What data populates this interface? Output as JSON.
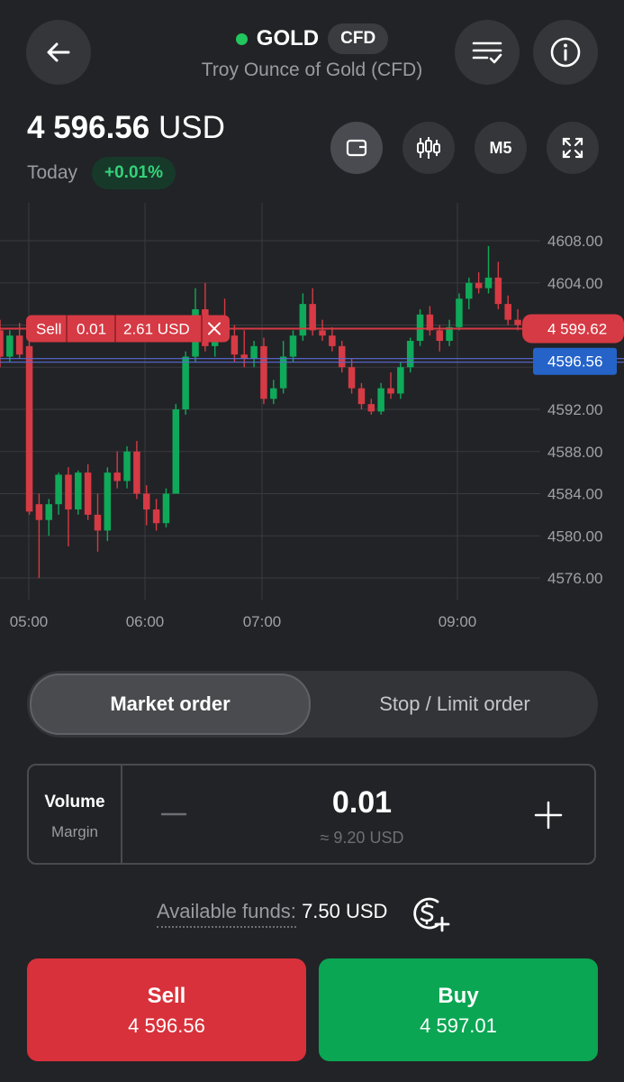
{
  "header": {
    "symbol": "GOLD",
    "badge": "CFD",
    "subtitle": "Troy Ounce of Gold (CFD)"
  },
  "price": {
    "value": "4 596.56",
    "currency": "USD",
    "period": "Today",
    "change": "+0.01%"
  },
  "toolbar": {
    "timeframe": "M5"
  },
  "chart_data": {
    "type": "candlestick",
    "y_ticks": [
      "4608.00",
      "4604.00",
      "4600.00",
      "4596.00",
      "4592.00",
      "4588.00",
      "4584.00",
      "4580.00",
      "4576.00"
    ],
    "x_ticks": [
      "05:00",
      "06:00",
      "07:00",
      "09:00"
    ],
    "ylim": [
      4574,
      4611
    ],
    "colors": {
      "up": "#0fa95a",
      "down": "#d63a44"
    },
    "order_line": {
      "side": "Sell",
      "volume": "0.01",
      "pnl": "2.61 USD",
      "price": "4 599.62"
    },
    "current_price_tag": "4596.56",
    "candles": [
      {
        "o": 4599.5,
        "h": 4600.5,
        "l": 4596.0,
        "c": 4597.0
      },
      {
        "o": 4597.0,
        "h": 4599.5,
        "l": 4596.5,
        "c": 4599.0
      },
      {
        "o": 4599.0,
        "h": 4600.2,
        "l": 4596.8,
        "c": 4597.2
      },
      {
        "o": 4598.0,
        "h": 4598.5,
        "l": 4582.0,
        "c": 4582.3
      },
      {
        "o": 4583.0,
        "h": 4584.0,
        "l": 4576.0,
        "c": 4581.5
      },
      {
        "o": 4581.5,
        "h": 4583.5,
        "l": 4580.0,
        "c": 4583.0
      },
      {
        "o": 4583.0,
        "h": 4586.0,
        "l": 4582.0,
        "c": 4585.8
      },
      {
        "o": 4585.8,
        "h": 4586.5,
        "l": 4579.0,
        "c": 4582.5
      },
      {
        "o": 4582.5,
        "h": 4586.2,
        "l": 4582.0,
        "c": 4586.0
      },
      {
        "o": 4586.0,
        "h": 4586.8,
        "l": 4581.5,
        "c": 4582.0
      },
      {
        "o": 4582.0,
        "h": 4584.0,
        "l": 4578.5,
        "c": 4580.5
      },
      {
        "o": 4580.5,
        "h": 4586.5,
        "l": 4579.5,
        "c": 4586.0
      },
      {
        "o": 4586.0,
        "h": 4588.0,
        "l": 4584.5,
        "c": 4585.2
      },
      {
        "o": 4585.2,
        "h": 4588.5,
        "l": 4584.5,
        "c": 4588.0
      },
      {
        "o": 4588.0,
        "h": 4589.0,
        "l": 4583.5,
        "c": 4584.0
      },
      {
        "o": 4584.0,
        "h": 4584.8,
        "l": 4581.0,
        "c": 4582.5
      },
      {
        "o": 4582.5,
        "h": 4583.5,
        "l": 4580.5,
        "c": 4581.2
      },
      {
        "o": 4581.2,
        "h": 4584.5,
        "l": 4580.8,
        "c": 4584.0
      },
      {
        "o": 4584.0,
        "h": 4592.5,
        "l": 4584.0,
        "c": 4592.0
      },
      {
        "o": 4592.0,
        "h": 4597.5,
        "l": 4591.5,
        "c": 4597.0
      },
      {
        "o": 4597.0,
        "h": 4603.5,
        "l": 4596.5,
        "c": 4601.5
      },
      {
        "o": 4601.5,
        "h": 4604.0,
        "l": 4597.5,
        "c": 4598.0
      },
      {
        "o": 4598.0,
        "h": 4600.5,
        "l": 4597.0,
        "c": 4600.0
      },
      {
        "o": 4600.0,
        "h": 4602.5,
        "l": 4598.5,
        "c": 4599.0
      },
      {
        "o": 4599.0,
        "h": 4600.0,
        "l": 4596.5,
        "c": 4597.2
      },
      {
        "o": 4597.2,
        "h": 4599.5,
        "l": 4596.0,
        "c": 4596.8
      },
      {
        "o": 4596.8,
        "h": 4598.5,
        "l": 4596.0,
        "c": 4598.0
      },
      {
        "o": 4598.0,
        "h": 4598.8,
        "l": 4592.5,
        "c": 4593.0
      },
      {
        "o": 4593.0,
        "h": 4594.8,
        "l": 4592.5,
        "c": 4594.0
      },
      {
        "o": 4594.0,
        "h": 4598.5,
        "l": 4593.5,
        "c": 4597.0
      },
      {
        "o": 4597.0,
        "h": 4599.5,
        "l": 4596.5,
        "c": 4599.0
      },
      {
        "o": 4599.0,
        "h": 4603.0,
        "l": 4598.5,
        "c": 4602.0
      },
      {
        "o": 4602.0,
        "h": 4603.5,
        "l": 4599.0,
        "c": 4599.5
      },
      {
        "o": 4599.5,
        "h": 4600.5,
        "l": 4598.5,
        "c": 4599.0
      },
      {
        "o": 4599.0,
        "h": 4599.8,
        "l": 4597.5,
        "c": 4598.0
      },
      {
        "o": 4598.0,
        "h": 4598.5,
        "l": 4595.5,
        "c": 4596.0
      },
      {
        "o": 4596.0,
        "h": 4596.8,
        "l": 4593.5,
        "c": 4594.0
      },
      {
        "o": 4594.0,
        "h": 4594.5,
        "l": 4592.0,
        "c": 4592.5
      },
      {
        "o": 4592.5,
        "h": 4593.0,
        "l": 4591.5,
        "c": 4591.8
      },
      {
        "o": 4591.8,
        "h": 4594.5,
        "l": 4591.5,
        "c": 4594.0
      },
      {
        "o": 4594.0,
        "h": 4595.5,
        "l": 4593.0,
        "c": 4593.5
      },
      {
        "o": 4593.5,
        "h": 4596.5,
        "l": 4593.0,
        "c": 4596.0
      },
      {
        "o": 4596.0,
        "h": 4598.8,
        "l": 4595.5,
        "c": 4598.5
      },
      {
        "o": 4598.5,
        "h": 4601.5,
        "l": 4598.0,
        "c": 4601.0
      },
      {
        "o": 4601.0,
        "h": 4601.8,
        "l": 4599.0,
        "c": 4599.5
      },
      {
        "o": 4599.5,
        "h": 4600.0,
        "l": 4597.5,
        "c": 4598.5
      },
      {
        "o": 4598.5,
        "h": 4600.5,
        "l": 4598.0,
        "c": 4599.8
      },
      {
        "o": 4599.8,
        "h": 4603.0,
        "l": 4599.5,
        "c": 4602.5
      },
      {
        "o": 4602.5,
        "h": 4604.5,
        "l": 4601.5,
        "c": 4604.0
      },
      {
        "o": 4604.0,
        "h": 4605.0,
        "l": 4603.0,
        "c": 4603.5
      },
      {
        "o": 4603.5,
        "h": 4607.5,
        "l": 4603.0,
        "c": 4604.5
      },
      {
        "o": 4604.5,
        "h": 4606.0,
        "l": 4601.5,
        "c": 4602.0
      },
      {
        "o": 4602.0,
        "h": 4602.8,
        "l": 4600.0,
        "c": 4600.5
      },
      {
        "o": 4600.5,
        "h": 4601.5,
        "l": 4599.5,
        "c": 4600.0
      },
      {
        "o": 4600.0,
        "h": 4600.8,
        "l": 4599.0,
        "c": 4599.5
      },
      {
        "o": 4599.5,
        "h": 4601.0,
        "l": 4597.0,
        "c": 4599.0
      },
      {
        "o": 4599.0,
        "h": 4600.5,
        "l": 4598.5,
        "c": 4600.0
      },
      {
        "o": 4600.5,
        "h": 4601.0,
        "l": 4596.5,
        "c": 4596.8
      }
    ]
  },
  "order_type": {
    "market": "Market order",
    "stop_limit": "Stop / Limit order"
  },
  "volume": {
    "label": "Volume",
    "margin_label": "Margin",
    "value": "0.01",
    "approx": "≈ 9.20 USD"
  },
  "funds": {
    "label": "Available funds:",
    "value": "7.50 USD"
  },
  "trade": {
    "sell_label": "Sell",
    "sell_price": "4 596.56",
    "buy_label": "Buy",
    "buy_price": "4 597.01"
  }
}
